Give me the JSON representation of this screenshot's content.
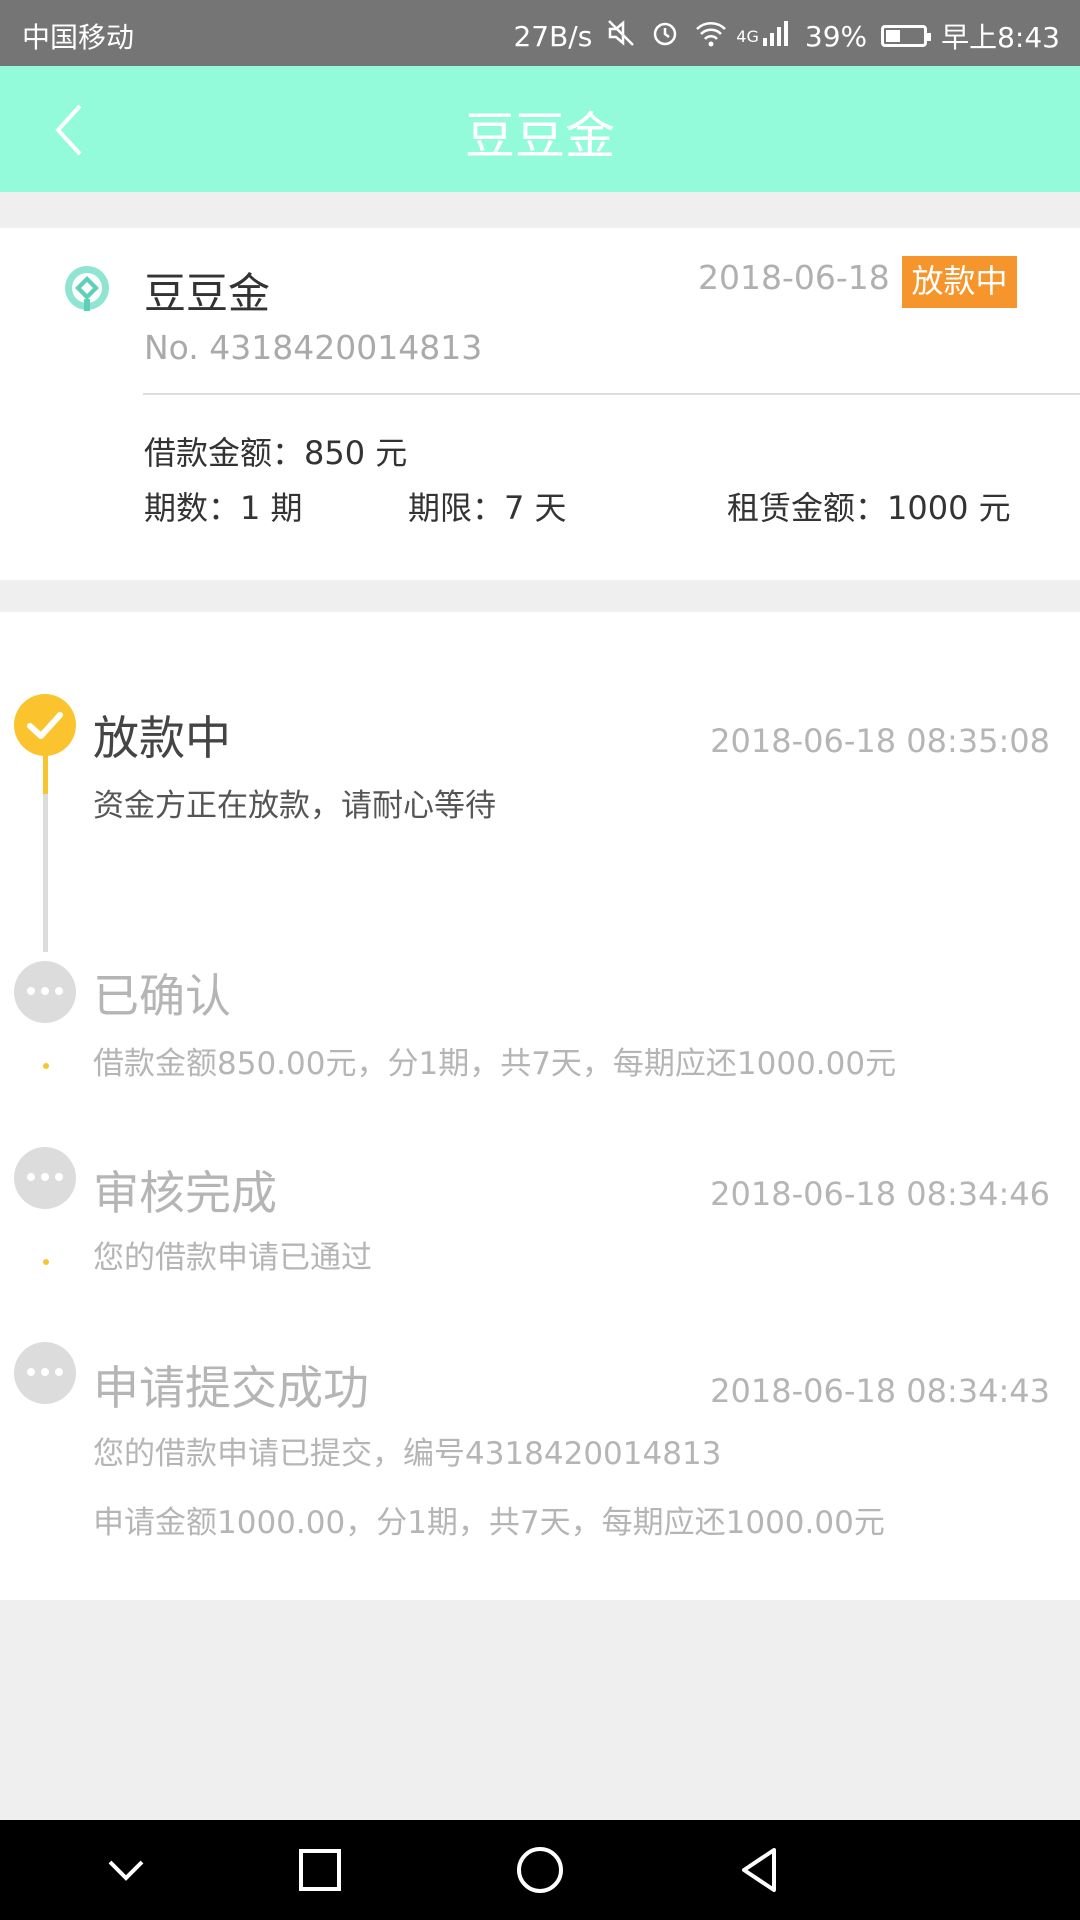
{
  "status_bar": {
    "carrier": "中国移动",
    "speed": "27B/s",
    "network": "4G",
    "battery": "39%",
    "battery_level": 0.39,
    "time": "早上8:43"
  },
  "header": {
    "title": "豆豆金"
  },
  "loan_card": {
    "product_name": "豆豆金",
    "date": "2018-06-18",
    "status_badge": "放款中",
    "order_no": "No. 4318420014813",
    "loan_amount": "借款金额：850 元",
    "periods": "期数：1 期",
    "term": "期限：7 天",
    "lease_amount": "租赁金额：1000 元"
  },
  "timeline": [
    {
      "title": "放款中",
      "time": "2018-06-18 08:35:08",
      "desc": "资金方正在放款，请耐心等待",
      "state": "done"
    },
    {
      "title": "已确认",
      "time": "",
      "desc": "借款金额850.00元，分1期，共7天，每期应还1000.00元",
      "state": "pending"
    },
    {
      "title": "审核完成",
      "time": "2018-06-18 08:34:46",
      "desc": "您的借款申请已通过",
      "state": "pending"
    },
    {
      "title": "申请提交成功",
      "time": "2018-06-18 08:34:43",
      "desc": "您的借款申请已提交，编号4318420014813",
      "desc2": "申请金额1000.00，分1期，共7天，每期应还1000.00元",
      "state": "pending"
    }
  ],
  "colors": {
    "header_bg": "#94fbda",
    "badge_bg": "#f6952c",
    "timeline_active": "#fbc32e",
    "timeline_pending": "#dcdcdc"
  },
  "icons": {
    "back": "chevron-left-icon",
    "logo": "app-logo-icon",
    "check": "check-icon",
    "more": "dots-icon",
    "nav_hide": "chevron-down-icon",
    "nav_recent": "square-icon",
    "nav_home": "circle-icon",
    "nav_back": "triangle-back-icon"
  }
}
